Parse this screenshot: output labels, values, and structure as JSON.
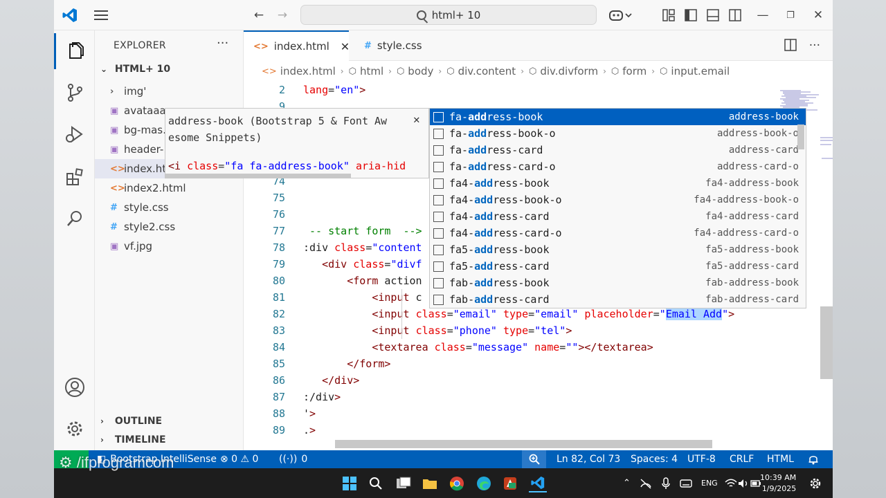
{
  "titlebar": {
    "search_text": "html+ 10"
  },
  "sidebar": {
    "title": "EXPLORER",
    "folder": "HTML+ 10",
    "items": [
      {
        "label": "img'",
        "icon": "chevron-right-icon",
        "glyph": "›"
      },
      {
        "label": "avataaa…",
        "icon": "image-file-icon",
        "glyph": "▣"
      },
      {
        "label": "bg-mas…",
        "icon": "image-file-icon",
        "glyph": "▣"
      },
      {
        "label": "header-…",
        "icon": "image-file-icon",
        "glyph": "▣"
      },
      {
        "label": "index.ht…",
        "icon": "html-file-icon",
        "glyph": "<>"
      },
      {
        "label": "index2.html",
        "icon": "html-file-icon",
        "glyph": "<>"
      },
      {
        "label": "style.css",
        "icon": "css-file-icon",
        "glyph": "#"
      },
      {
        "label": "style2.css",
        "icon": "css-file-icon",
        "glyph": "#"
      },
      {
        "label": "vf.jpg",
        "icon": "image-file-icon",
        "glyph": "▣"
      }
    ],
    "outline": "OUTLINE",
    "timeline": "TIMELINE"
  },
  "tabs": [
    {
      "label": "index.html",
      "icon": "html-file-icon",
      "glyph": "<>",
      "close": "✕"
    },
    {
      "label": "style.css",
      "icon": "css-file-icon",
      "glyph": "#"
    }
  ],
  "breadcrumb": [
    "index.html",
    "html",
    "body",
    "div.content",
    "div.divform",
    "form",
    "input.email"
  ],
  "code_lines": [
    {
      "n": "2",
      "text": "lang=\"en\">"
    },
    {
      "n": "9",
      "text": ""
    },
    {
      "n": "74",
      "text": ""
    },
    {
      "n": "75",
      "text": ""
    },
    {
      "n": "76",
      "text": ""
    },
    {
      "n": "77",
      "text": " -- start form  -->"
    },
    {
      "n": "78",
      "text": ":div class=\"content"
    },
    {
      "n": "79",
      "text": "   <div class=\"divf"
    },
    {
      "n": "80",
      "text": "       <form action"
    },
    {
      "n": "81",
      "text": "           <input c"
    },
    {
      "n": "82",
      "text": "           <input class=\"email\" type=\"email\" placeholder=\"Email Add\">"
    },
    {
      "n": "83",
      "text": "           <input class=\"phone\" type=\"tel\">"
    },
    {
      "n": "84",
      "text": "           <textarea class=\"message\" name=\"\"></textarea>"
    },
    {
      "n": "85",
      "text": "       </form>"
    },
    {
      "n": "86",
      "text": "   </div>"
    },
    {
      "n": "87",
      "text": ":/div>"
    },
    {
      "n": "88",
      "text": "'>"
    },
    {
      "n": "89",
      "text": ".>"
    }
  ],
  "hover": {
    "title": "address-book (Bootstrap 5 & Font Aw esome Snippets)",
    "close": "✕",
    "code": "<i class=\"fa fa-address-book\" aria-hid"
  },
  "suggestions": [
    {
      "pre": "fa-",
      "match": "add",
      "post": "ress-book",
      "detail": "address-book"
    },
    {
      "pre": "fa-",
      "match": "add",
      "post": "ress-book-o",
      "detail": "address-book-o"
    },
    {
      "pre": "fa-",
      "match": "add",
      "post": "ress-card",
      "detail": "address-card"
    },
    {
      "pre": "fa-",
      "match": "add",
      "post": "ress-card-o",
      "detail": "address-card-o"
    },
    {
      "pre": "fa4-",
      "match": "add",
      "post": "ress-book",
      "detail": "fa4-address-book"
    },
    {
      "pre": "fa4-",
      "match": "add",
      "post": "ress-book-o",
      "detail": "fa4-address-book-o"
    },
    {
      "pre": "fa4-",
      "match": "add",
      "post": "ress-card",
      "detail": "fa4-address-card"
    },
    {
      "pre": "fa4-",
      "match": "add",
      "post": "ress-card-o",
      "detail": "fa4-address-card-o"
    },
    {
      "pre": "fa5-",
      "match": "add",
      "post": "ress-book",
      "detail": "fa5-address-book"
    },
    {
      "pre": "fa5-",
      "match": "add",
      "post": "ress-card",
      "detail": "fa5-address-card"
    },
    {
      "pre": "fab-",
      "match": "add",
      "post": "ress-book",
      "detail": "fab-address-book"
    },
    {
      "pre": "fab-",
      "match": "add",
      "post": "ress-card",
      "detail": "fab-address-card"
    }
  ],
  "status": {
    "extension": "Bootstrap IntelliSense",
    "errors": "⊗ 0 ⚠ 0",
    "ports": "0",
    "position": "Ln 82, Col 73",
    "spaces": "Spaces: 4",
    "encoding": "UTF-8",
    "eol": "CRLF",
    "language": "HTML"
  },
  "taskbar": {
    "lang": "ENG",
    "time": "10:39 AM",
    "date": "1/9/2025"
  },
  "watermark": "/ifprogramcom",
  "colors": {
    "accent": "#005fb8",
    "statusbar": "#005fb8",
    "selection": "#0060c0"
  }
}
